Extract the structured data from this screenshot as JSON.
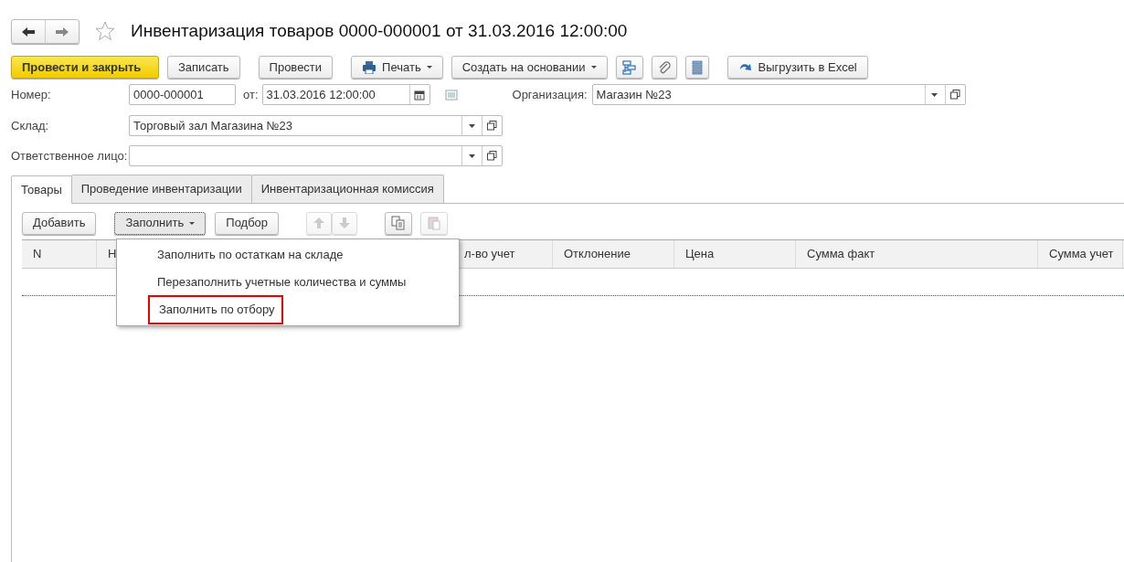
{
  "window": {
    "title": "Инвентаризация товаров 0000-000001 от 31.03.2016 12:00:00",
    "favorite": false
  },
  "toolbar": [
    {
      "kind": "primary",
      "label": "Провести и закрыть"
    },
    {
      "kind": "text",
      "label": "Записать"
    },
    {
      "kind": "text",
      "label": "Провести"
    },
    {
      "kind": "print",
      "label": "Печать",
      "dropdown": true
    },
    {
      "kind": "text",
      "label": "Создать на основании",
      "dropdown": true
    },
    {
      "kind": "structure"
    },
    {
      "kind": "attach"
    },
    {
      "kind": "list"
    },
    {
      "kind": "export",
      "label": "Выгрузить в Excel"
    }
  ],
  "fields": {
    "number": {
      "label": "Номер:",
      "value": "0000-000001"
    },
    "date": {
      "label": "от:",
      "value": "31.03.2016 12:00:00"
    },
    "organization": {
      "label": "Организация:",
      "value": "Магазин №23"
    },
    "warehouse": {
      "label": "Склад:",
      "value": "Торговый зал Магазина №23"
    },
    "responsible": {
      "label": "Ответственное лицо:"
    }
  },
  "tabs": [
    {
      "label": "Товары",
      "selected": true
    },
    {
      "label": "Проведение инвентаризации",
      "selected": false
    },
    {
      "label": "Инвентаризационная комиссия",
      "selected": false
    }
  ],
  "table_toolbar": [
    {
      "kind": "text",
      "label": "Добавить",
      "disabled": false
    },
    {
      "kind": "text",
      "label": "Заполнить",
      "dropdown": true,
      "expanded": true,
      "disabled": false
    },
    {
      "kind": "text",
      "label": "Подбор",
      "disabled": false
    },
    {
      "kind": "up",
      "disabled": true
    },
    {
      "kind": "down",
      "disabled": true
    },
    {
      "kind": "copy",
      "disabled": false
    },
    {
      "kind": "paste",
      "disabled": true
    }
  ],
  "fill_menu": [
    {
      "label": "Заполнить по остаткам на складе",
      "outlined": false
    },
    {
      "label": "Перезаполнить учетные количества и суммы",
      "outlined": false
    },
    {
      "label": "Заполнить по отбору",
      "outlined": true
    }
  ],
  "table": {
    "columns": [
      "N",
      "Н",
      "л-во учет",
      "Отклонение",
      "Цена",
      "Сумма факт",
      "Сумма учет"
    ]
  }
}
